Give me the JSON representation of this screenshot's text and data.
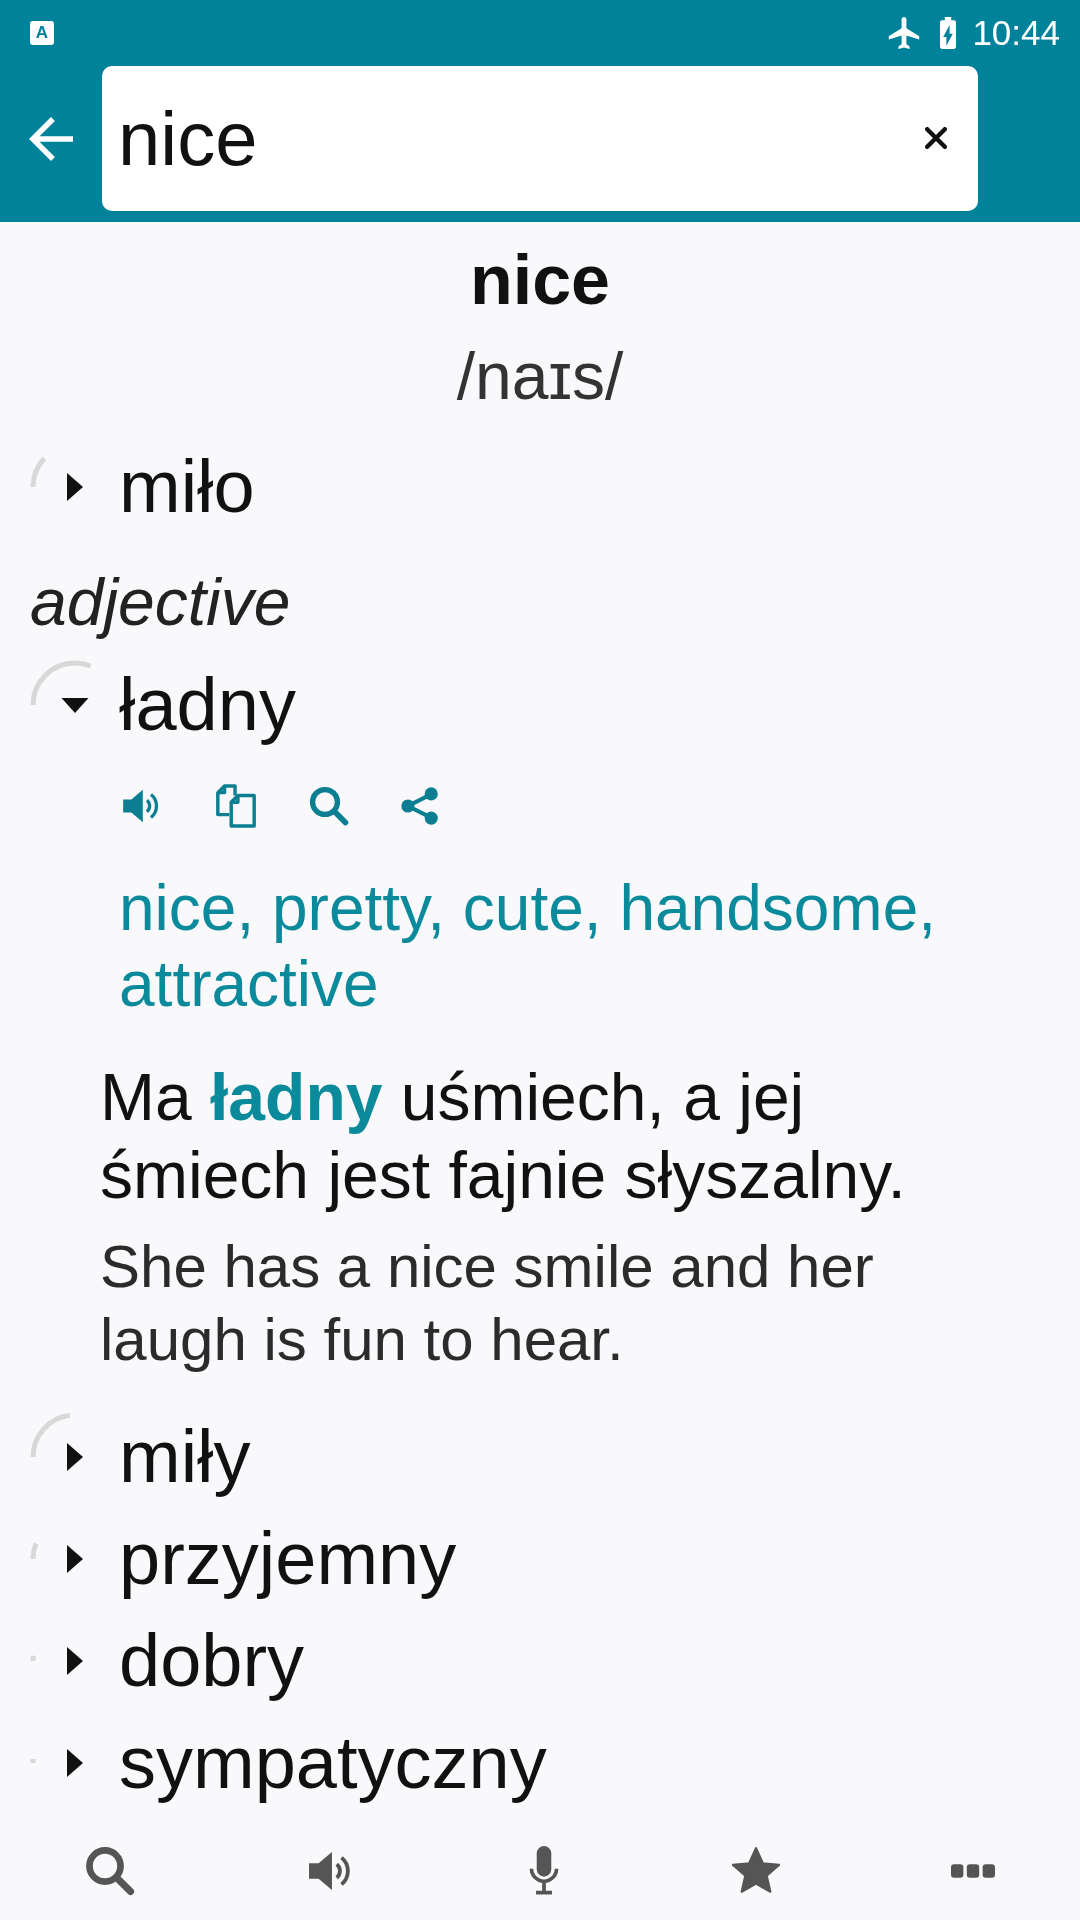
{
  "status_bar": {
    "app_icon_letter": "A",
    "time": "10:44"
  },
  "search": {
    "value": "nice"
  },
  "entry": {
    "headword": "nice",
    "pronunciation": "/naɪs/"
  },
  "senses": [
    {
      "kind": "translation",
      "text": "miło",
      "expanded": false,
      "level": 0.12
    },
    {
      "kind": "part_of_speech",
      "text": "adjective"
    },
    {
      "kind": "translation",
      "text": "ładny",
      "expanded": true,
      "level": 0.31,
      "meanings": "nice, pretty, cute, handsome, attractive",
      "example": {
        "source": "Ma **ładny** uśmiech, a jej śmiech jest fajnie słyszalny.",
        "translation": "She has a nice smile and her laugh is fun to hear."
      }
    },
    {
      "kind": "translation",
      "text": "miły",
      "expanded": false,
      "level": 0.23
    },
    {
      "kind": "translation",
      "text": "przyjemny",
      "expanded": false,
      "level": 0.06
    },
    {
      "kind": "translation",
      "text": "dobry",
      "expanded": false,
      "level": 0.02
    },
    {
      "kind": "translation",
      "text": "sympatyczny",
      "expanded": false,
      "level": 0.015
    }
  ]
}
